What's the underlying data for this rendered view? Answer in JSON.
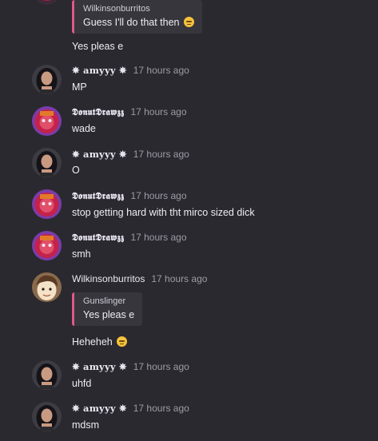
{
  "messages": [
    {
      "quote": {
        "user": "Wilkinsonburritos",
        "text": "Guess I'll do that then"
      },
      "text": "Yes pleas e"
    },
    {
      "user": "✵ 𝐚𝐦𝐲𝐲𝐲 ✵",
      "time": "17 hours ago",
      "text": "MP"
    },
    {
      "user": "𝕯𝖔𝖓𝖚𝖙𝕯𝖗𝖆𝖜𝖟𝖟",
      "time": "17 hours ago",
      "text": "wade"
    },
    {
      "user": "✵ 𝐚𝐦𝐲𝐲𝐲 ✵",
      "time": "17 hours ago",
      "text": "O"
    },
    {
      "user": "𝕯𝖔𝖓𝖚𝖙𝕯𝖗𝖆𝖜𝖟𝖟",
      "time": "17 hours ago",
      "text": "stop getting hard with tht mirco sized dick"
    },
    {
      "user": "𝕯𝖔𝖓𝖚𝖙𝕯𝖗𝖆𝖜𝖟𝖟",
      "time": "17 hours ago",
      "text": "smh"
    },
    {
      "user": "Wilkinsonburritos",
      "time": "17 hours ago",
      "quote": {
        "user": "Gunslinger",
        "text": "Yes pleas e"
      },
      "text": "Heheheh"
    },
    {
      "user": "✵ 𝐚𝐦𝐲𝐲𝐲 ✵",
      "time": "17 hours ago",
      "text": "uhfd"
    },
    {
      "user": "✵ 𝐚𝐦𝐲𝐲𝐲 ✵",
      "time": "17 hours ago",
      "text": "mdsm"
    }
  ],
  "emoji": {
    "name": "smirk-emoji",
    "color": "#f5c33b"
  },
  "colors": {
    "background": "#2a292f",
    "quote_bar": "#e0588f",
    "quote_bg": "#37363d",
    "timestamp": "#9d9ba6"
  }
}
